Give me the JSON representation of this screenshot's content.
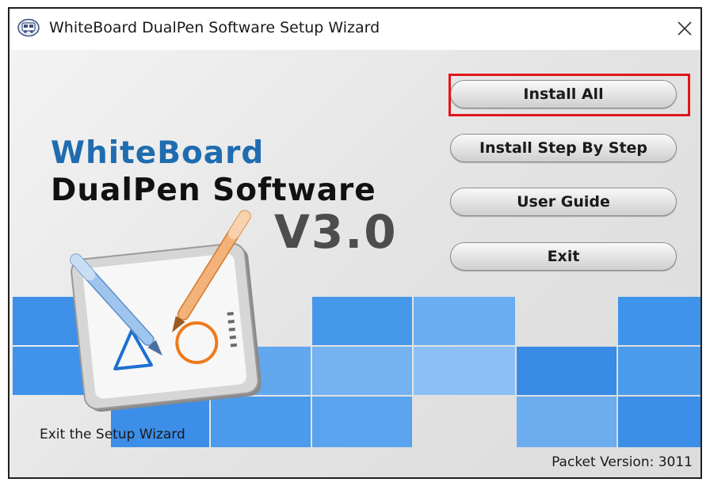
{
  "window": {
    "title": "WhiteBoard DualPen Software Setup Wizard",
    "close_glyph": "✕",
    "app_icon": "bus-icon"
  },
  "hero": {
    "line1": "WhiteBoard",
    "line2": "DualPen Software",
    "version": "V3.0",
    "brand_blue": "#1f6cb0"
  },
  "buttons": {
    "install_all": "Install All",
    "install_step": "Install Step By Step",
    "user_guide": "User Guide",
    "exit": "Exit"
  },
  "status": {
    "message": "Exit the Setup Wizard",
    "packet_version": "Packet Version: 3011"
  },
  "colors": {
    "highlight": "#e3141b",
    "tile_blue": "#3f93ea"
  }
}
